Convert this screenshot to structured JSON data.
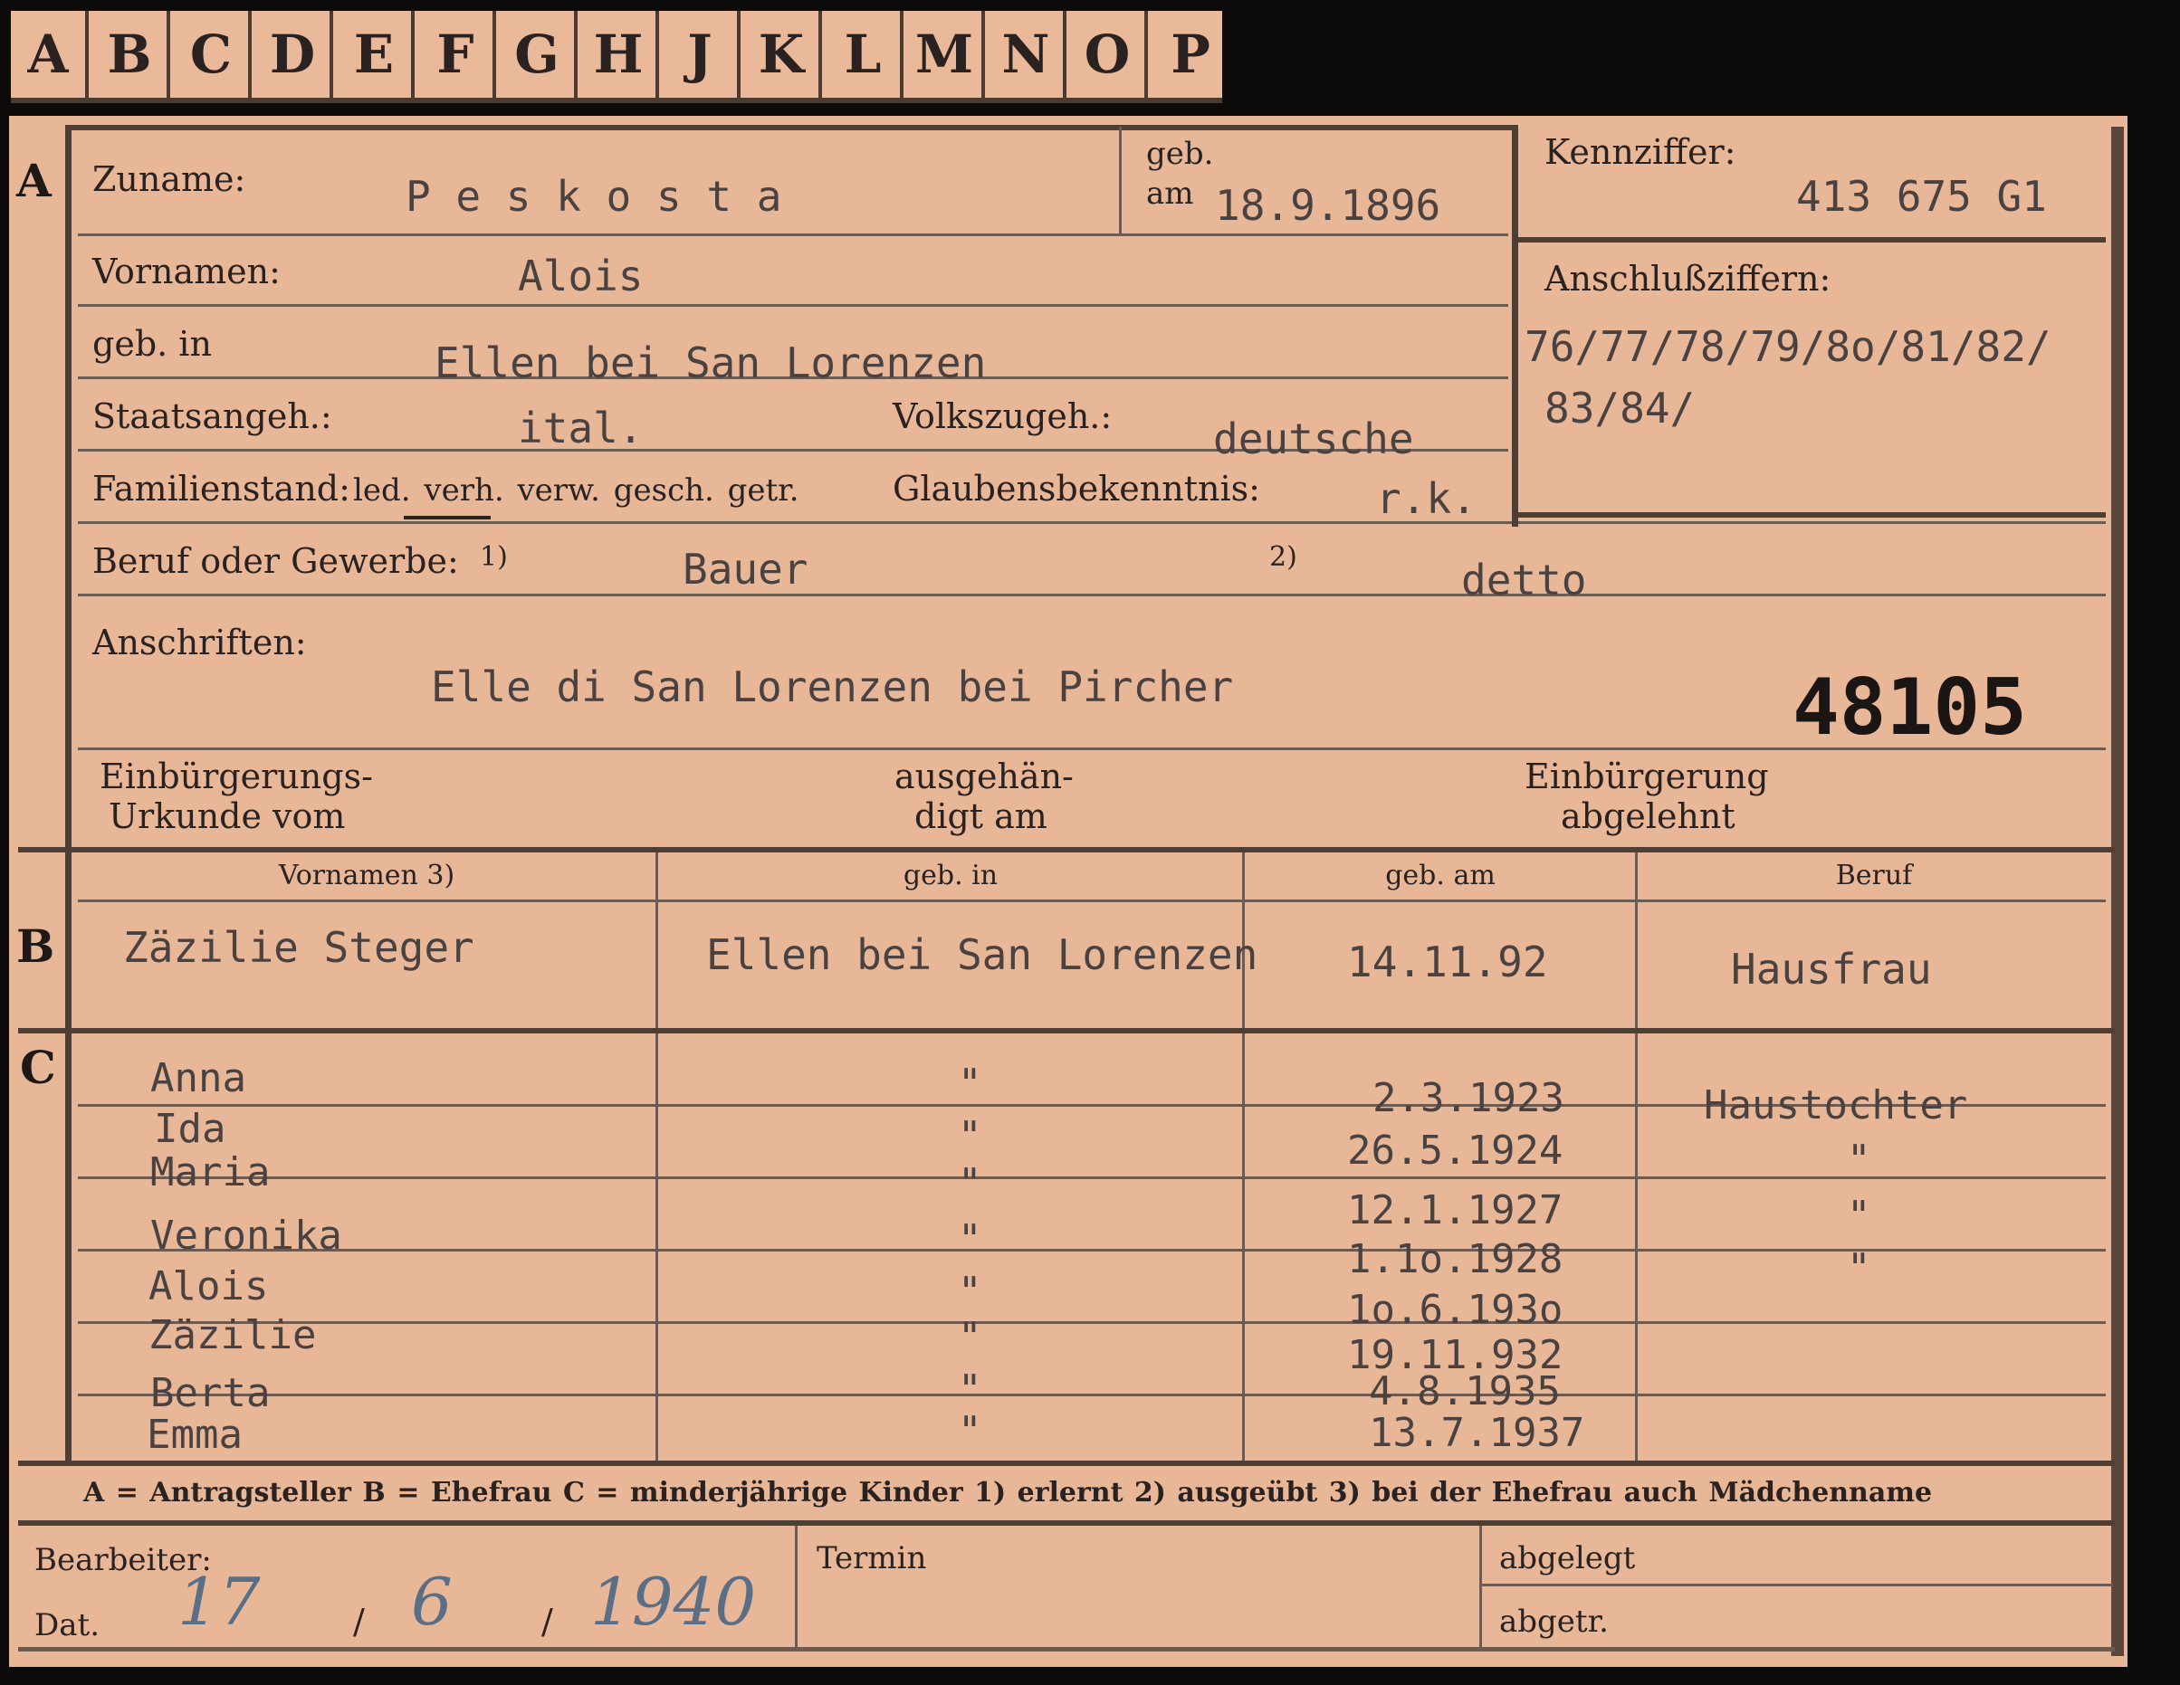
{
  "tabs": [
    "A",
    "B",
    "C",
    "D",
    "E",
    "F",
    "G",
    "H",
    "J",
    "K",
    "L",
    "M",
    "N",
    "O",
    "P"
  ],
  "sections": {
    "a": "A",
    "b": "B",
    "c": "C"
  },
  "applicant": {
    "surname_label": "Zuname:",
    "surname": "P e s k o s t a",
    "born_label_top": "geb.",
    "born_label_bottom": "am",
    "born_date": "18.9.1896",
    "ident_label": "Kennziffer:",
    "ident_value": "413 675  G1",
    "given_names_label": "Vornamen:",
    "given_names": "Alois",
    "birthplace_label": "geb. in",
    "birthplace": "Ellen bei San Lorenzen",
    "attach_label": "Anschlußziffern:",
    "attach_line1": "76/77/78/79/8o/81/82/",
    "attach_line2": "83/84/",
    "citizenship_label": "Staatsangeh.:",
    "citizenship": "ital.",
    "ethnicity_label": "Volkszugeh.:",
    "ethnicity": "deutsche",
    "marital_label": "Familienstand:",
    "marital_options": "led.  verh.  verw.  gesch.  getr.",
    "religion_label": "Glaubensbekenntnis:",
    "religion": "r.k.",
    "occupation_label": "Beruf oder Gewerbe:",
    "occupation_note1": "1)",
    "occupation_learned": "Bauer",
    "occupation_note2": "2)",
    "occupation_practiced": "detto",
    "address_label": "Anschriften:",
    "address": "Elle di San Lorenzen bei Pircher",
    "stamp_number": "48105",
    "naturalization_label_1": "Einbürgerungs-",
    "naturalization_label_2": "Urkunde vom",
    "handed_label_1": "ausgehän-",
    "handed_label_2": "digt am",
    "rejected_label_1": "Einbürgerung",
    "rejected_label_2": "abgelehnt"
  },
  "spouse": {
    "headers": [
      "Vornamen 3)",
      "geb. in",
      "geb. am",
      "Beruf"
    ],
    "name": "Zäzilie Steger",
    "birthplace": "Ellen bei San Lorenzen",
    "birthdate": "14.11.92",
    "occupation": "Hausfrau"
  },
  "children": [
    {
      "name": "Anna",
      "place": "\"",
      "date": "2.3.1923",
      "occupation": "Haustochter"
    },
    {
      "name": "Ida",
      "place": "\"",
      "date": "26.5.1924",
      "occupation": "\""
    },
    {
      "name": "Maria",
      "place": "\"",
      "date": "12.1.1927",
      "occupation": "\""
    },
    {
      "name": "Veronika",
      "place": "\"",
      "date": "1.1o.1928",
      "occupation": "\""
    },
    {
      "name": "Alois",
      "place": "\"",
      "date": "1o.6.193o",
      "occupation": ""
    },
    {
      "name": "Zäzilie",
      "place": "\"",
      "date": "19.11.932",
      "occupation": ""
    },
    {
      "name": "Berta",
      "place": "\"",
      "date": "4.8.1935",
      "occupation": ""
    },
    {
      "name": "Emma",
      "place": "\"",
      "date": "13.7.1937",
      "occupation": ""
    }
  ],
  "legend": "A = Antragsteller   B = Ehefrau   C = minderjährige Kinder   1) erlernt   2) ausgeübt   3) bei der Ehefrau auch Mädchenname",
  "footer": {
    "clerk_label": "Bearbeiter:",
    "date_label": "Dat.",
    "date_handwritten_day": "17",
    "date_handwritten_month": "6",
    "date_handwritten_year": "1940",
    "date_sep": "/",
    "deadline_label": "Termin",
    "filed_label": "abgelegt",
    "separated_label": "abgetr."
  },
  "colors": {
    "paper": "#e8b798",
    "ink": "#2a2220",
    "type": "#4a4240",
    "background": "#0d0b0a"
  }
}
